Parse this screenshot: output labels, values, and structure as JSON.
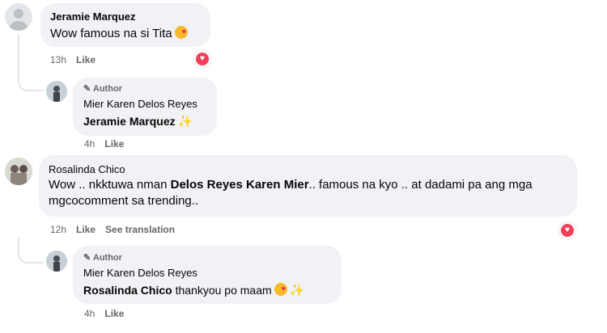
{
  "comments": [
    {
      "author": "Jeramie Marquez",
      "text": "Wow famous na si Tita",
      "emoji": "smiling-face-with-hearts-emoji",
      "time": "13h",
      "like": "Like",
      "reaction": "love-reaction",
      "reply": {
        "tag": "Author",
        "author": "Mier Karen Delos Reyes",
        "mention": "Jeramie Marquez",
        "text": "",
        "emoji": "sparkles-emoji",
        "time": "4h",
        "like": "Like"
      }
    },
    {
      "author": "Rosalinda Chico",
      "text_before": "Wow .. nkktuwa nman ",
      "mention": "Delos Reyes Karen Mier",
      "text_after": ".. famous na kyo .. at dadami pa ang mga mgcocomment sa trending..",
      "time": "12h",
      "like": "Like",
      "see_translation": "See translation",
      "reaction": "love-reaction",
      "reply": {
        "tag": "Author",
        "author": "Mier Karen Delos Reyes",
        "mention": "Rosalinda Chico",
        "text": " thankyou po maam",
        "emoji": "smiling-face-with-hearts-emoji sparkles-emoji",
        "time": "4h",
        "like": "Like"
      }
    }
  ],
  "colors": {
    "bubble": "#f0f2f5",
    "meta": "#65676b",
    "love": "#f33e58"
  }
}
